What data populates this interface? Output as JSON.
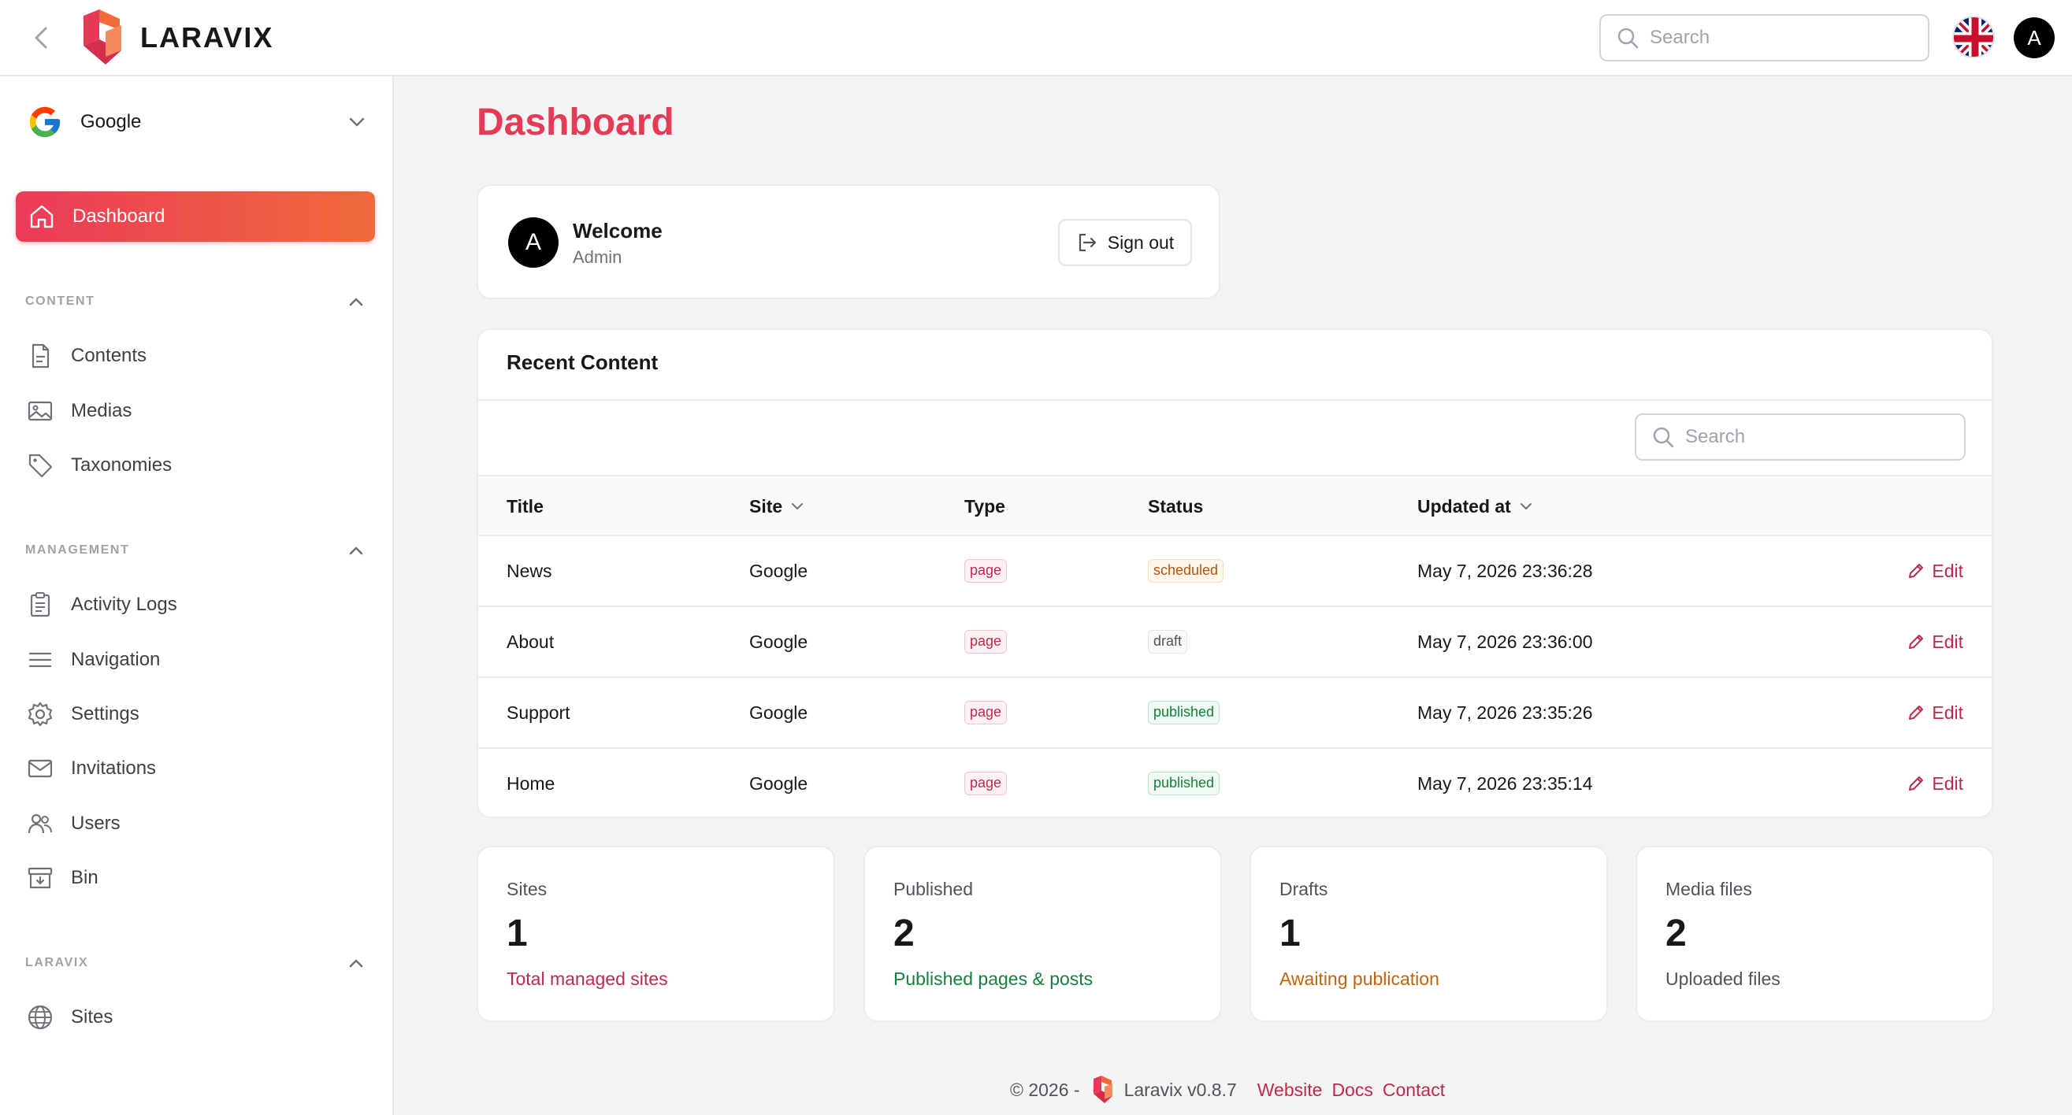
{
  "topbar": {
    "brand": "LARAVIX",
    "search_placeholder": "Search",
    "avatar_initial": "A"
  },
  "sidebar": {
    "site_name": "Google",
    "dashboard_label": "Dashboard",
    "sections": {
      "content": "CONTENT",
      "management": "MANAGEMENT",
      "laravix": "LARAVIX"
    },
    "content_items": [
      "Contents",
      "Medias",
      "Taxonomies"
    ],
    "management_items": [
      "Activity Logs",
      "Navigation",
      "Settings",
      "Invitations",
      "Users",
      "Bin"
    ],
    "laravix_items": [
      "Sites"
    ]
  },
  "main": {
    "title": "Dashboard",
    "welcome": {
      "avatar_initial": "A",
      "title": "Welcome",
      "subtitle": "Admin",
      "signout_label": "Sign out"
    },
    "recent": {
      "title": "Recent Content",
      "search_placeholder": "Search",
      "columns": [
        "Title",
        "Site",
        "Type",
        "Status",
        "Updated at"
      ],
      "edit_label": "Edit",
      "rows": [
        {
          "title": "News",
          "site": "Google",
          "type": "page",
          "status": "scheduled",
          "updated": "May 7, 2026 23:36:28"
        },
        {
          "title": "About",
          "site": "Google",
          "type": "page",
          "status": "draft",
          "updated": "May 7, 2026 23:36:00"
        },
        {
          "title": "Support",
          "site": "Google",
          "type": "page",
          "status": "published",
          "updated": "May 7, 2026 23:35:26"
        },
        {
          "title": "Home",
          "site": "Google",
          "type": "page",
          "status": "published",
          "updated": "May 7, 2026 23:35:14"
        }
      ]
    },
    "stats": [
      {
        "label": "Sites",
        "value": "1",
        "desc": "Total managed sites",
        "color": "#be2a4a"
      },
      {
        "label": "Published",
        "value": "2",
        "desc": "Published pages & posts",
        "color": "#15803d"
      },
      {
        "label": "Drafts",
        "value": "1",
        "desc": "Awaiting publication",
        "color": "#c2620c"
      },
      {
        "label": "Media files",
        "value": "2",
        "desc": "Uploaded files",
        "color": "#52525b"
      }
    ]
  },
  "footer": {
    "copyright": "© 2026 -",
    "version": "Laravix v0.8.7",
    "links": [
      "Website",
      "Docs",
      "Contact"
    ]
  },
  "colors": {
    "accent": "#e63a57",
    "accent_gradient_end": "#f06a3a",
    "badge_page": "#be2a4a",
    "badge_scheduled": "#b45309",
    "badge_draft": "#52525b",
    "badge_published": "#15803d"
  }
}
